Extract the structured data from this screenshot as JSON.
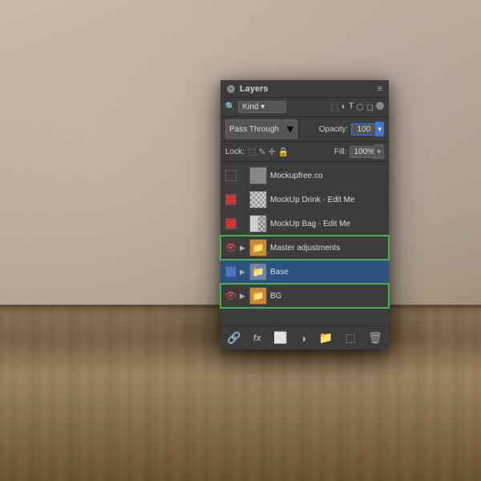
{
  "background": {
    "alt": "textured wall and wooden table"
  },
  "panel": {
    "title": "Layers",
    "close_label": "×",
    "menu_label": "≡",
    "filter": {
      "search_icon": "🔍",
      "kind_label": "Kind",
      "icon_pixel": "⬚",
      "icon_circle": "◐",
      "icon_type": "T",
      "icon_shape": "⬡",
      "icon_smart": "⬜",
      "dot_label": "●"
    },
    "blend": {
      "mode_label": "Pass Through",
      "dropdown_arrow": "▾",
      "opacity_label": "Opacity:",
      "opacity_value": "100",
      "opacity_unit": "%",
      "opacity_arrow": "▾"
    },
    "lock": {
      "label": "Lock:",
      "icon_transparent": "⬚",
      "icon_brush": "✎",
      "icon_move": "✛",
      "icon_lock": "🔒",
      "fill_label": "Fill:",
      "fill_value": "100%",
      "fill_arrow": "▾"
    },
    "layers": [
      {
        "id": "layer-mockupfree",
        "name": "Mockupfree.co",
        "has_eye": false,
        "eye_visible": false,
        "eye_type": "checkbox",
        "thumb_type": "dots",
        "has_expand": false,
        "is_group": false,
        "selected": false,
        "highlighted": false
      },
      {
        "id": "layer-drink",
        "name": "MockUp Drink - Edit Me",
        "has_eye": true,
        "eye_visible": false,
        "eye_type": "red-square",
        "thumb_type": "checker-small",
        "has_expand": false,
        "is_group": false,
        "selected": false,
        "highlighted": false
      },
      {
        "id": "layer-bag",
        "name": "MockUp Bag - Edit Me",
        "has_eye": true,
        "eye_visible": false,
        "eye_type": "red-square",
        "thumb_type": "bag",
        "has_expand": false,
        "is_group": false,
        "selected": false,
        "highlighted": false
      },
      {
        "id": "layer-master",
        "name": "Master adjustments",
        "has_eye": true,
        "eye_visible": true,
        "eye_type": "red-eye",
        "thumb_type": "folder-orange",
        "has_expand": true,
        "is_group": true,
        "selected": false,
        "highlighted": true
      },
      {
        "id": "layer-base",
        "name": "Base",
        "has_eye": false,
        "eye_visible": false,
        "eye_type": "blue-square",
        "thumb_type": "folder-blue",
        "has_expand": true,
        "is_group": true,
        "selected": true,
        "highlighted": false
      },
      {
        "id": "layer-bg",
        "name": "BG",
        "has_eye": true,
        "eye_visible": true,
        "eye_type": "eye",
        "thumb_type": "folder-orange",
        "has_expand": true,
        "is_group": true,
        "selected": false,
        "highlighted": true
      }
    ],
    "toolbar": {
      "link_icon": "🔗",
      "fx_label": "fx",
      "mask_icon": "⬜",
      "circle_icon": "◑",
      "folder_icon": "📁",
      "adjust_icon": "⬚",
      "trash_icon": "🗑"
    }
  }
}
